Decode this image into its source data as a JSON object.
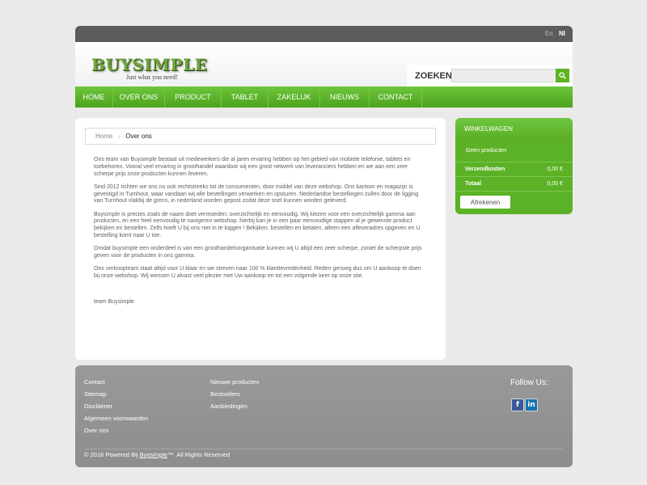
{
  "languages": {
    "en": "En",
    "nl": "Nl"
  },
  "brand": {
    "logo": "BUYSIMPLE",
    "tagline": "Just what you need!"
  },
  "search": {
    "label": "ZOEKEN",
    "value": ""
  },
  "nav": [
    "HOME",
    "OVER ONS",
    "PRODUCT",
    "TABLET",
    "ZAKELIJK",
    "NIEUWS",
    "CONTACT"
  ],
  "breadcrumb": {
    "home": "Home",
    "separator": "›",
    "current": "Over ons"
  },
  "article": {
    "paragraphs": [
      "Ons team van Buysimple bestaat uit medewerkers die al jaren ervaring hebben op het gebied van mobiele telefonie, tablets en toebehoren. Vooral veel ervaring in groothandel waardoor wij een groot netwerk van leveranciers hebben en we aan een zeer scherpe prijs onze producten kunnen leveren.",
      "Sind 2012 richten we ons nu ook rechtstreeks tot de consumenten, door middel van deze webshop. Ons kantoor en magazijn is gevestigd in Turnhout, waar vandaan wij alle bestellingen verwerken en opsturen. Nederlandse bestellingen zullen door de ligging van Turnhout vlakbij de grens, in nederland worden gepost zodat deze snel kunnen worden geleverd.",
      "Buysimple is precies zoals de naam doet vermoeden: overzichtelijk en eenvoudig. Wij kiezen voor een overzichtelijk gamma aan producten, en een heel eenvoudig te navigeren webshop. hierbij kan je in een paar eenvoudige stappen al je gewenste product bekijken en bestellen. Zelfs hoeft U bij ons niet in te loggen ! Bekijken, bestellen en betalen, alleen een afleveradres opgeven en U bestelling komt naar U toe.",
      "Omdat buysimple een onderdeel is van een groothandelsorganisatie kunnen wij U altijd een zeer scherpe, zoniet de scherpste prijs geven voor de producten in ons gamma.",
      "Ons verkoopteam staat altijd voor U klaar en we streven naar 100 % klanttevredenheid. Reden genoeg dus om U aankoop te doen bij onze webshop. Wij wensen U alvast veel plezier met Uw aankoop en tot een volgende keer op onze site."
    ],
    "signature": "team Buysimple"
  },
  "cart": {
    "title": "WINKELWAGEN",
    "empty": "Geen producten",
    "rows": [
      {
        "label": "Verzendkosten",
        "value": "0,00 €"
      },
      {
        "label": "Totaal",
        "value": "0,00 €"
      }
    ],
    "checkout": "Afrekenen"
  },
  "footer": {
    "col1": [
      "Contact",
      "Sitemap",
      "Disclaimer",
      "Algemeen voorwaarden",
      "Over ons"
    ],
    "col2": [
      "Nieuwe producten",
      "Bestsellers",
      "Aanbiedingen"
    ],
    "follow": "Follow Us:",
    "social": {
      "facebook": "f",
      "linkedin": "in"
    },
    "copyright_prefix": "© 2016 Powered Bij ",
    "copyright_brand": "Buysimple",
    "copyright_suffix": "™. All Rights Reserved"
  },
  "colors": {
    "accent": "#5cb423",
    "topbar": "#5c5c5c",
    "footer": "#999999"
  }
}
